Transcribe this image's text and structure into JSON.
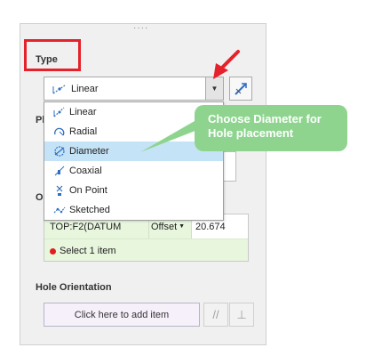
{
  "type_section": {
    "label": "Type",
    "selected": "Linear",
    "dropdown_icon": "caret-down-icon",
    "flip_icon": "flip-direction-icon"
  },
  "dropdown_items": [
    {
      "label": "Linear",
      "icon": "linear-icon"
    },
    {
      "label": "Radial",
      "icon": "radial-icon"
    },
    {
      "label": "Diameter",
      "icon": "diameter-icon",
      "selected": true
    },
    {
      "label": "Coaxial",
      "icon": "coaxial-icon"
    },
    {
      "label": "On Point",
      "icon": "on-point-icon"
    },
    {
      "label": "Sketched",
      "icon": "sketched-icon"
    }
  ],
  "partial_labels": {
    "placement": "Pl",
    "offset": "O"
  },
  "references": {
    "row1": {
      "ref": "TOP:F2(DATUM",
      "type": "Offset",
      "value": "20.674"
    },
    "row2": {
      "ref": "Select 1 item"
    }
  },
  "hole_orientation": {
    "label": "Hole Orientation",
    "add_item": "Click here to add item",
    "parallel_icon": "parallel-icon",
    "perpendicular_icon": "perpendicular-icon"
  },
  "callout": {
    "line1": "Choose Diameter for",
    "line2": "Hole placement"
  },
  "colors": {
    "highlight": "#e5222b",
    "callout": "#8ed48f",
    "selected_item": "#c5e3f6",
    "reference_bg": "#e8f6de"
  }
}
